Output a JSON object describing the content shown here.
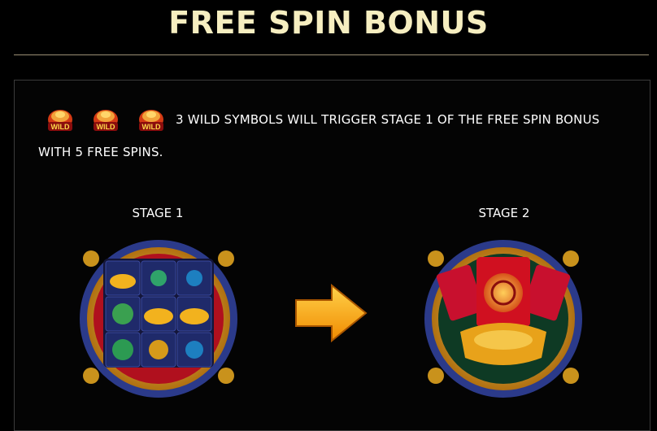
{
  "header": {
    "title": "FREE SPIN BONUS"
  },
  "rules": {
    "wild_symbol_label": "WILD",
    "line1": "3 WILD SYMBOLS WILL TRIGGER STAGE 1 OF THE FREE SPIN BONUS",
    "line2": "WITH 5 FREE SPINS."
  },
  "stages": [
    {
      "label": "STAGE 1"
    },
    {
      "label": "STAGE 2"
    }
  ],
  "colors": {
    "title": "#f6eec0",
    "gold": "#e6b020",
    "red": "#c8102e",
    "arrow": "#ffb400",
    "background": "#000000"
  },
  "icons": {
    "wild": "wild-icon",
    "arrow": "arrow-right-icon"
  }
}
